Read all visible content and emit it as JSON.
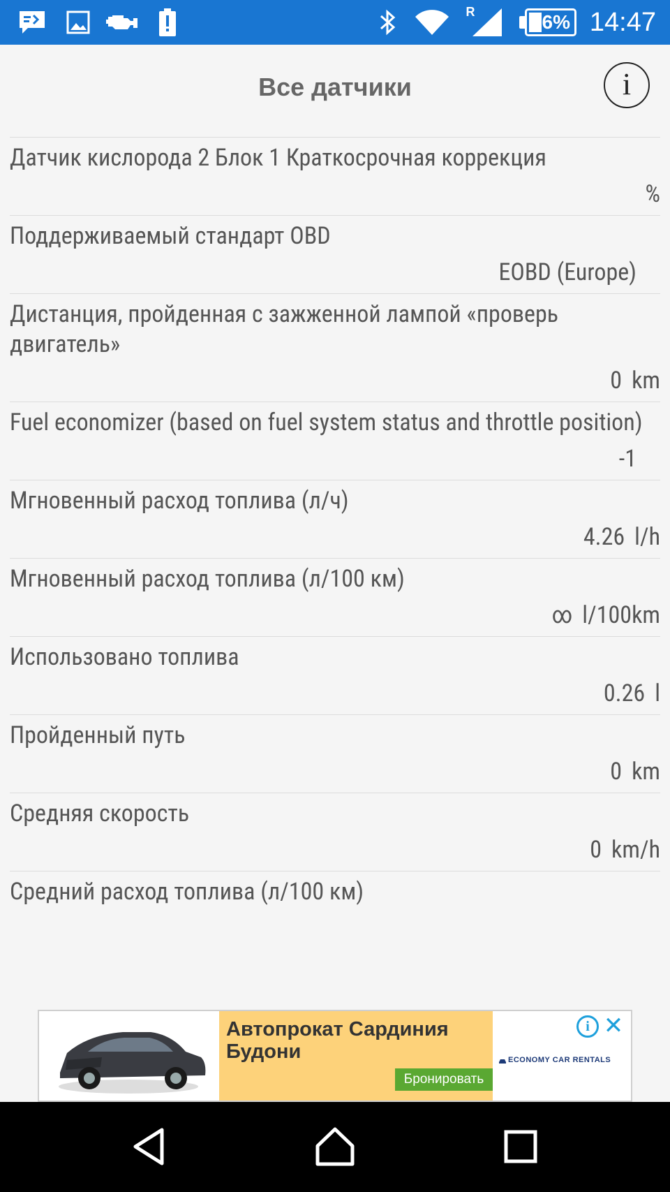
{
  "status_bar": {
    "time": "14:47",
    "battery_percent": "26%",
    "battery_level": 0.26,
    "roaming_indicator": "R",
    "icons": [
      "message-icon",
      "image-icon",
      "engine-icon",
      "battery-alert-icon",
      "bluetooth-icon",
      "wifi-icon",
      "cell-signal-icon",
      "battery-icon"
    ]
  },
  "header": {
    "title": "Все датчики",
    "info_glyph": "i"
  },
  "sensors": [
    {
      "label": "Датчик кислорода 2 Блок 1 Краткосрочная коррекция",
      "value": "",
      "unit": "%"
    },
    {
      "label": "Поддерживаемый стандарт OBD",
      "value": "EOBD (Europe)",
      "unit": ""
    },
    {
      "label": "Дистанция, пройденная с зажженной лампой «проверь двигатель»",
      "value": "0",
      "unit": "km"
    },
    {
      "label": "Fuel economizer (based on fuel system status and throttle position)",
      "value": "-1",
      "unit": ""
    },
    {
      "label": "Мгновенный расход топлива (л/ч)",
      "value": "4.26",
      "unit": "l/h"
    },
    {
      "label": "Мгновенный расход топлива (л/100 км)",
      "value": "∞",
      "unit": "l/100km"
    },
    {
      "label": "Использовано топлива",
      "value": "0.26",
      "unit": "l"
    },
    {
      "label": "Пройденный путь",
      "value": "0",
      "unit": "km"
    },
    {
      "label": "Средняя скорость",
      "value": "0",
      "unit": "km/h"
    },
    {
      "label": "Средний расход топлива (л/100 км)",
      "value": "",
      "unit": ""
    }
  ],
  "ad": {
    "title": "Автопрокат Сардиния Будони",
    "cta": "Бронировать",
    "brand": "ECONOMY CAR RENTALS",
    "info_glyph": "i",
    "close_glyph": "✕"
  },
  "colors": {
    "status_bar": "#1976d2",
    "background": "#f5f5f5",
    "ad_background": "#fdd27a",
    "ad_cta": "#5aa832",
    "ad_accent": "#1ea0dc",
    "nav_bar": "#000000"
  },
  "nav": {
    "buttons": [
      "back-icon",
      "home-icon",
      "recents-icon"
    ]
  }
}
